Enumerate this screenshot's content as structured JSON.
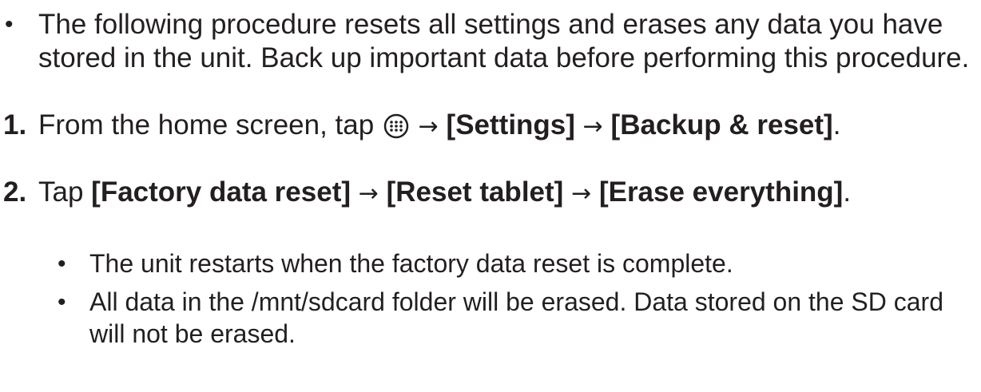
{
  "note": {
    "bullet": "•",
    "text": "The following procedure resets all settings and erases any data you have stored in the unit. Back up important data before performing this procedure."
  },
  "steps": [
    {
      "number": "1.",
      "prefix": "From the home screen, tap",
      "icon": "apps-icon",
      "arrow": "→",
      "settings": "[Settings]",
      "backup": "[Backup & reset]",
      "end": "."
    },
    {
      "number": "2.",
      "tap": "Tap",
      "factory": "[Factory data reset]",
      "arrow": "→",
      "reset_tablet": "[Reset tablet]",
      "erase": "[Erase everything]",
      "end": ".",
      "notes": [
        "The unit restarts when the factory data reset is complete.",
        "All data in the /mnt/sdcard folder will be erased. Data stored on the SD card will not be erased."
      ]
    }
  ]
}
